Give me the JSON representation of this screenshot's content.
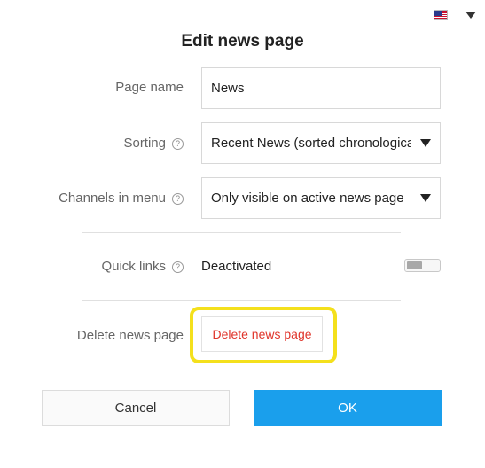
{
  "language": {
    "flag": "uk-flag-icon",
    "caret": "chevron-down-icon"
  },
  "dialog": {
    "title": "Edit news page",
    "page_name": {
      "label": "Page name",
      "value": "News"
    },
    "sorting": {
      "label": "Sorting",
      "help": "?",
      "value": "Recent News (sorted chronologically)"
    },
    "channels": {
      "label": "Channels in menu",
      "help": "?",
      "value": "Only visible on active news page"
    },
    "quick_links": {
      "label": "Quick links",
      "help": "?",
      "value": "Deactivated",
      "enabled": false
    },
    "delete": {
      "label": "Delete news page",
      "button": "Delete news page"
    },
    "buttons": {
      "cancel": "Cancel",
      "ok": "OK"
    }
  },
  "colors": {
    "primary": "#1a9fec",
    "danger": "#e0352b",
    "highlight": "#f4e01c"
  }
}
